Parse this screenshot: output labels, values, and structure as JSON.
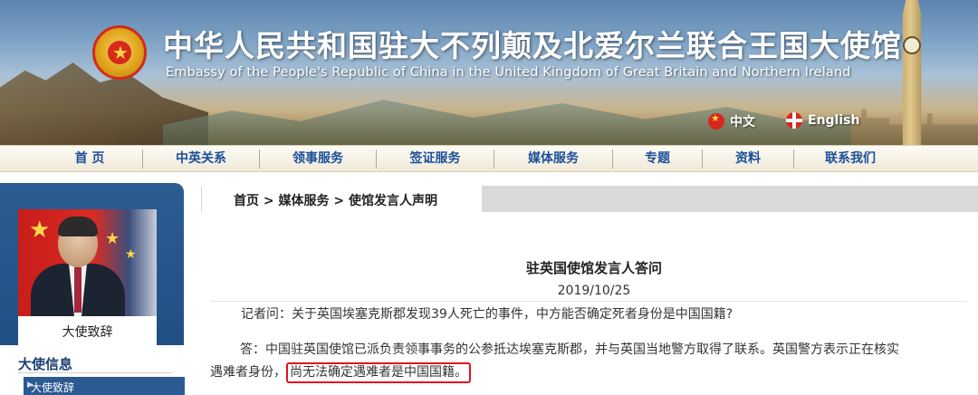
{
  "banner": {
    "title_cn": "中华人民共和国驻大不列颠及北爱尔兰联合王国大使馆",
    "title_en": "Embassy of the People's Republic of China in the United Kingdom of Great Britain and Northern Ireland",
    "lang_cn": "中文",
    "lang_en": "English"
  },
  "nav": {
    "items": [
      "首 页",
      "中英关系",
      "领事服务",
      "签证服务",
      "媒体服务",
      "专题",
      "资料",
      "联系我们"
    ]
  },
  "sidebar": {
    "portrait_caption": "大使致辞",
    "section_title": "大使信息",
    "section_item": "大使致辞"
  },
  "breadcrumb": "首页 > 媒体服务 > 使馆发言人声明",
  "article": {
    "title": "驻英国使馆发言人答问",
    "date": "2019/10/25",
    "question": "记者问：关于英国埃塞克斯郡发现39人死亡的事件，中方能否确定死者身份是中国国籍?",
    "answer_line1": "答：中国驻英国使馆已派负责领事事务的公参抵达埃塞克斯郡，并与英国当地警方取得了联系。英国警方表示正在核实",
    "answer_line2_start": "遇难者身份，",
    "answer_line2_highlight": "尚无法确定遇难者是中国国籍。"
  },
  "colors": {
    "nav_text": "#1b4f99",
    "sidebar_bg": "#2d5c93",
    "highlight_border": "#e0141b"
  }
}
